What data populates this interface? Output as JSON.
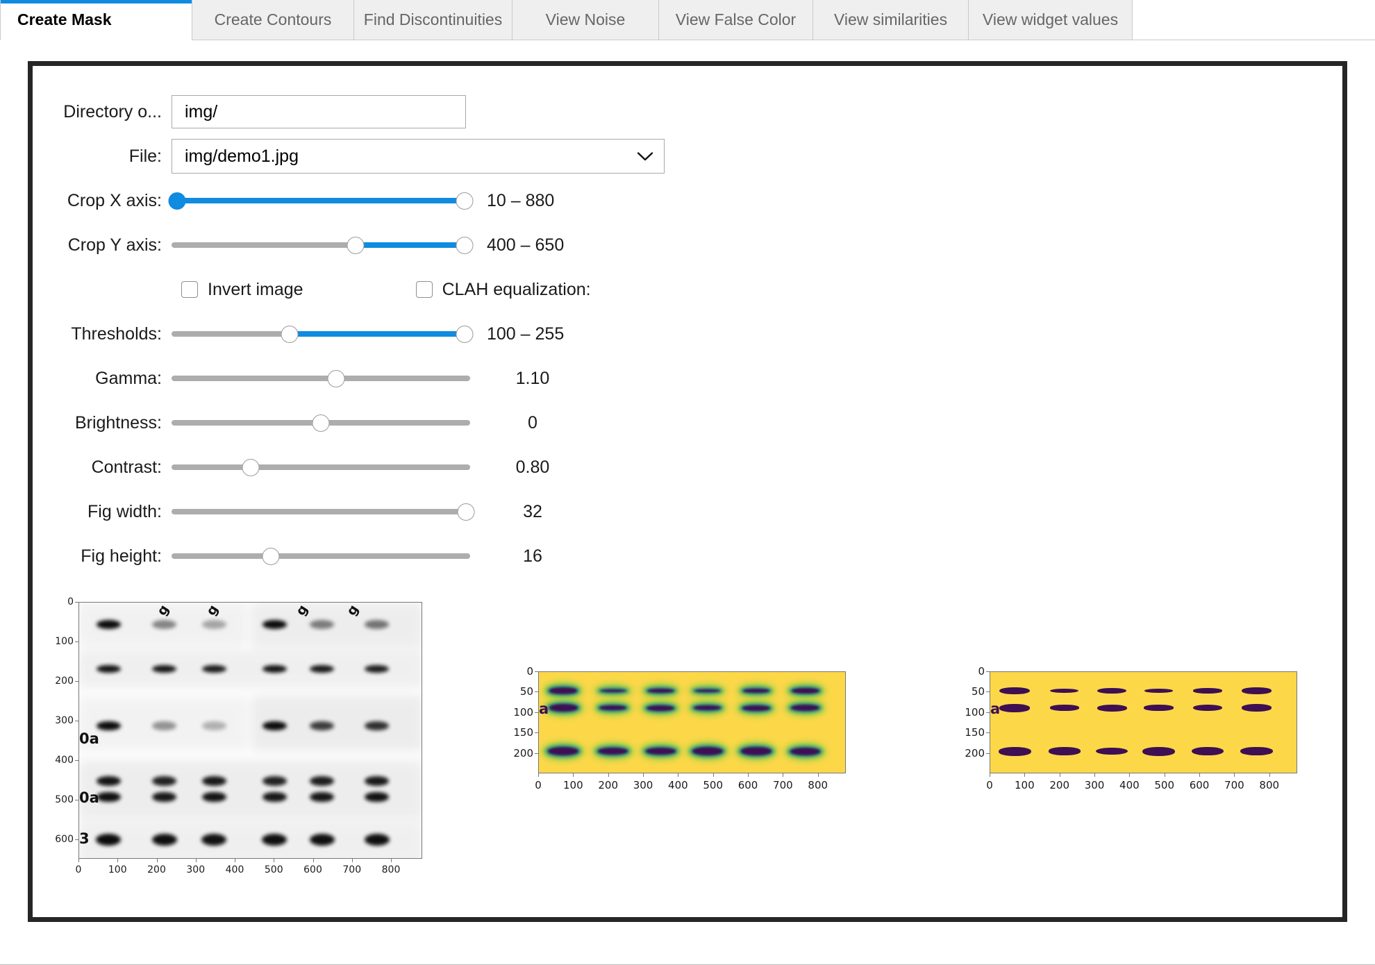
{
  "theme": {
    "accent": "#0f8be0",
    "viridis_yellow": "#fcd849",
    "viridis_dark": "#3e0f52",
    "viridis_teal": "#2a9089",
    "viridis_green": "#8fd044",
    "panel_border": "#262626"
  },
  "tabs": [
    {
      "label": "Create Mask",
      "active": true
    },
    {
      "label": "Create Contours",
      "active": false
    },
    {
      "label": "Find Discontinuities",
      "active": false
    },
    {
      "label": "View Noise",
      "active": false
    },
    {
      "label": "View False Color",
      "active": false
    },
    {
      "label": "View similarities",
      "active": false
    },
    {
      "label": "View widget values",
      "active": false
    }
  ],
  "controls": {
    "directory": {
      "label": "Directory o...",
      "value": "img/",
      "placeholder": "img/"
    },
    "file": {
      "label": "File:",
      "value": "img/demo1.jpg",
      "options": [
        "img/demo1.jpg"
      ],
      "icon": "chevron-down-icon"
    },
    "crop_x": {
      "label": "Crop X axis:",
      "value_text": "10 – 880",
      "min": 0,
      "max": 900,
      "low": 10,
      "high": 880
    },
    "crop_y": {
      "label": "Crop Y axis:",
      "value_text": "400 – 650",
      "min": 0,
      "max": 1000,
      "low": 400,
      "high": 650
    },
    "invert": {
      "label": "Invert image",
      "checked": false
    },
    "clahe": {
      "label": "CLAH equalization:",
      "checked": false
    },
    "thresholds": {
      "label": "Thresholds:",
      "value_text": "100 – 255",
      "min": 0,
      "max": 255,
      "low": 100,
      "high": 255
    },
    "gamma": {
      "label": "Gamma:",
      "value_text": "1.10",
      "min": 0,
      "max": 2,
      "value": 1.1
    },
    "brightness": {
      "label": "Brightness:",
      "value_text": "0",
      "min": -100,
      "max": 100,
      "value": 0
    },
    "contrast": {
      "label": "Contrast:",
      "value_text": "0.80",
      "min": 0,
      "max": 3,
      "value": 0.8
    },
    "fig_width": {
      "label": "Fig width:",
      "value_text": "32",
      "min": 4,
      "max": 32,
      "value": 32
    },
    "fig_height": {
      "label": "Fig height:",
      "value_text": "16",
      "min": 4,
      "max": 32,
      "value": 16
    }
  },
  "chart_data": [
    {
      "id": "source-blot",
      "type": "heatmap",
      "title": "",
      "xlabel": "",
      "ylabel": "",
      "xlim": [
        0,
        880
      ],
      "ylim": [
        650,
        0
      ],
      "xticks": [
        0,
        100,
        200,
        300,
        400,
        500,
        600,
        700,
        800
      ],
      "yticks": [
        0,
        100,
        200,
        300,
        400,
        500,
        600
      ],
      "colormap": "gray-inverted",
      "grid": false,
      "axis_label_fragments": [
        "0a",
        "0a",
        "3"
      ],
      "band_rows_y": [
        55,
        168,
        310,
        455,
        492,
        600
      ],
      "lane_centers_x": [
        75,
        220,
        345,
        500,
        620,
        760
      ],
      "description": "Western blot source image, 6 lanes x 5-6 band rows, grayscale"
    },
    {
      "id": "false-color-crop",
      "type": "heatmap",
      "title": "",
      "xlabel": "",
      "ylabel": "",
      "xlim": [
        0,
        880
      ],
      "ylim": [
        250,
        0
      ],
      "xticks": [
        0,
        100,
        200,
        300,
        400,
        500,
        600,
        700,
        800
      ],
      "yticks": [
        0,
        50,
        100,
        150,
        200
      ],
      "colormap": "viridis",
      "grid": false,
      "axis_label_fragments": [
        "a"
      ],
      "band_rows_y": [
        48,
        88,
        195
      ],
      "lane_centers_x": [
        70,
        210,
        345,
        480,
        620,
        760
      ],
      "description": "Cropped region (Y 400-650) rendered with viridis false color"
    },
    {
      "id": "binary-mask",
      "type": "heatmap",
      "title": "",
      "xlabel": "",
      "ylabel": "",
      "xlim": [
        0,
        880
      ],
      "ylim": [
        250,
        0
      ],
      "xticks": [
        0,
        100,
        200,
        300,
        400,
        500,
        600,
        700,
        800
      ],
      "yticks": [
        0,
        50,
        100,
        150,
        200
      ],
      "colormap": "viridis-binary",
      "grid": false,
      "axis_label_fragments": [
        "a"
      ],
      "band_rows_y": [
        48,
        88,
        192
      ],
      "lane_centers_x": [
        70,
        210,
        345,
        480,
        620,
        760
      ],
      "description": "Thresholded binary mask of the cropped region (thresholds 100-255)"
    }
  ]
}
